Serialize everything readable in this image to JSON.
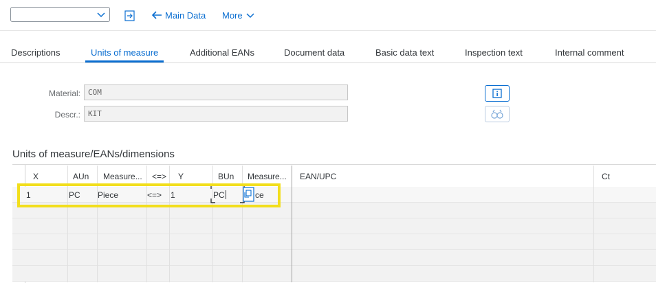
{
  "toolbar": {
    "dropdown_value": "",
    "main_data_label": "Main Data",
    "more_label": "More"
  },
  "tabs": [
    {
      "label": "Descriptions"
    },
    {
      "label": "Units of measure"
    },
    {
      "label": "Additional EANs"
    },
    {
      "label": "Document data"
    },
    {
      "label": "Basic data text"
    },
    {
      "label": "Inspection text"
    },
    {
      "label": "Internal comment"
    }
  ],
  "header_fields": {
    "material_label": "Material:",
    "material_value": "COM",
    "descr_label": "Descr.:",
    "descr_value": "KIT"
  },
  "section_title": "Units of measure/EANs/dimensions",
  "table": {
    "columns": [
      "X",
      "AUn",
      "Measure...",
      "<=>",
      "Y",
      "BUn",
      "Measure...",
      "EAN/UPC",
      "Ct"
    ],
    "rows": [
      [
        "1",
        "PC",
        "Piece",
        "<=>",
        "1",
        "PC",
        "ce",
        "",
        ""
      ]
    ]
  },
  "colors": {
    "accent": "#0a6ed1",
    "highlight": "#f2de1c"
  }
}
